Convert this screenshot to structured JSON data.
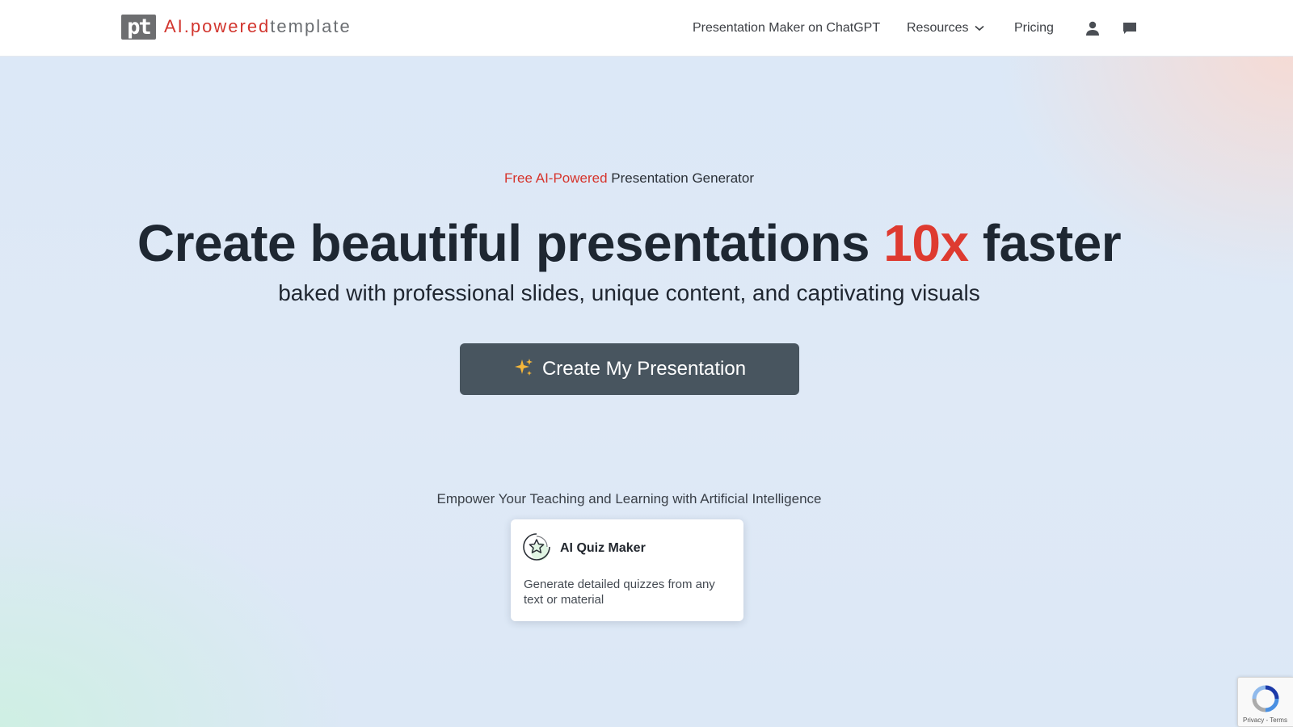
{
  "header": {
    "logo_mark": "pt",
    "logo_red": "AI.powered",
    "logo_grey": "template",
    "nav": {
      "chatgpt": "Presentation Maker on ChatGPT",
      "resources": "Resources",
      "pricing": "Pricing"
    },
    "icons": {
      "resources_chevron": "chevron-down-icon",
      "user": "user-icon",
      "chat": "chat-icon"
    }
  },
  "hero": {
    "eyebrow_accent": "Free AI-Powered",
    "eyebrow_rest": "Presentation Generator",
    "headline_before": "Create beautiful presentations",
    "headline_accent": "10x",
    "headline_after": "faster",
    "subhead": "baked with professional slides, unique content, and captivating visuals",
    "cta_label": "Create My Presentation",
    "cta_icon": "sparkle-icon"
  },
  "section": {
    "title": "Empower Your Teaching and Learning with Artificial Intelligence",
    "cards": [
      {
        "icon": "star-badge-icon",
        "title": "AI Quiz Maker",
        "description": "Generate detailed quizzes from any text or material"
      }
    ]
  },
  "recaptcha": {
    "terms": "Privacy - Terms"
  },
  "colors": {
    "accent_red": "#de3a30",
    "cta_bg": "#48555f",
    "text_dark": "#1e2732"
  }
}
